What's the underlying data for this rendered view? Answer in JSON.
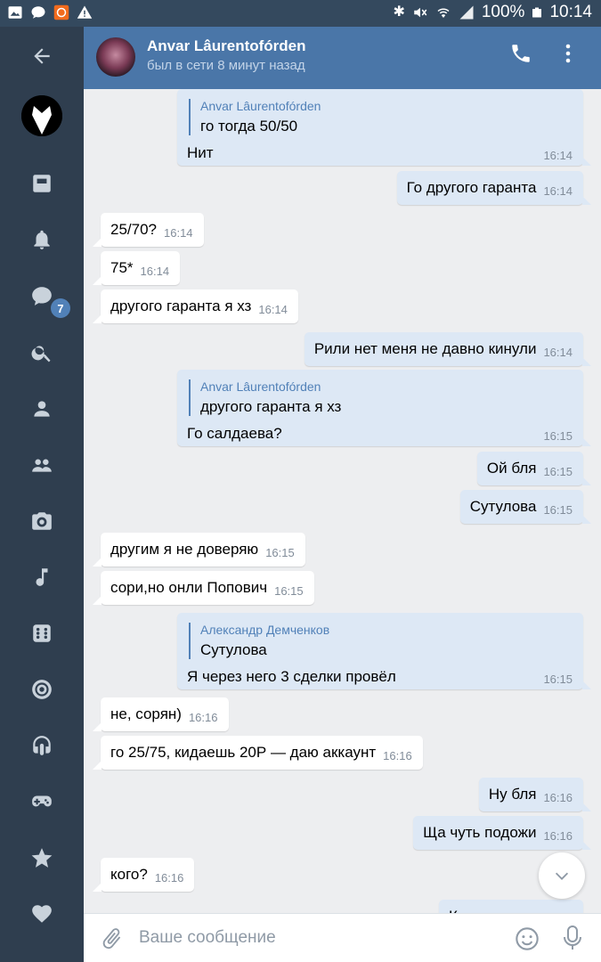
{
  "status_bar": {
    "battery": "100%",
    "time": "10:14",
    "icons": [
      "gallery-icon",
      "chat-bubble-icon",
      "app-icon",
      "warning-icon",
      "bluetooth-icon",
      "mute-icon",
      "wifi-icon",
      "signal-icon",
      "battery-icon"
    ]
  },
  "sidebar": {
    "items": [
      "back-arrow-icon",
      "profile-avatar",
      "news-icon",
      "bell-icon",
      "messages-icon",
      "search-icon",
      "user-icon",
      "friends-icon",
      "camera-icon",
      "music-icon",
      "apps-icon",
      "target-icon",
      "podcast-icon",
      "gamepad-icon",
      "star-icon",
      "heart-icon"
    ],
    "badge_count": "7"
  },
  "header": {
    "name": "Anvar Lâurentofórden",
    "status": "был в сети 8 минут назад",
    "color": "#4a76a8"
  },
  "messages": [
    {
      "dir": "out",
      "reply_author": "Anvar Lâurentofórden",
      "reply_text": "го тогда 50/50",
      "text": "Нит",
      "time": "16:14"
    },
    {
      "dir": "out",
      "text": "Го другого гаранта",
      "time": "16:14"
    },
    {
      "dir": "in",
      "text": "25/70?",
      "time": "16:14"
    },
    {
      "dir": "in",
      "text": "75*",
      "time": "16:14"
    },
    {
      "dir": "in",
      "text": "другого гаранта я хз",
      "time": "16:14"
    },
    {
      "dir": "out",
      "text": "Рили нет меня не давно кинули",
      "time": "16:14"
    },
    {
      "dir": "out",
      "reply_author": "Anvar Lâurentofórden",
      "reply_text": "другого гаранта я хз",
      "text": "Го салдаева?",
      "time": "16:15"
    },
    {
      "dir": "out",
      "text": "Ой бля",
      "time": "16:15"
    },
    {
      "dir": "out",
      "text": "Сутулова",
      "time": "16:15"
    },
    {
      "dir": "in",
      "text": "другим я не доверяю",
      "time": "16:15"
    },
    {
      "dir": "in",
      "text": "сори,но онли Попович",
      "time": "16:15"
    },
    {
      "dir": "out",
      "reply_author": "Александр Демченков",
      "reply_text": "Сутулова",
      "text": "Я через него 3 сделки провёл",
      "time": "16:15"
    },
    {
      "dir": "in",
      "text": "не, сорян)",
      "time": "16:16"
    },
    {
      "dir": "in",
      "text": "го 25/75, кидаешь 20Р — даю аккаунт",
      "time": "16:16"
    },
    {
      "dir": "out",
      "text": "Ну бля",
      "time": "16:16"
    },
    {
      "dir": "out",
      "text": "Ща чуть подожи",
      "time": "16:16"
    },
    {
      "dir": "in",
      "text": "кого?",
      "time": "16:16"
    },
    {
      "dir": "out",
      "text": "К",
      "time": ""
    }
  ],
  "input": {
    "placeholder": "Ваше сообщение"
  }
}
